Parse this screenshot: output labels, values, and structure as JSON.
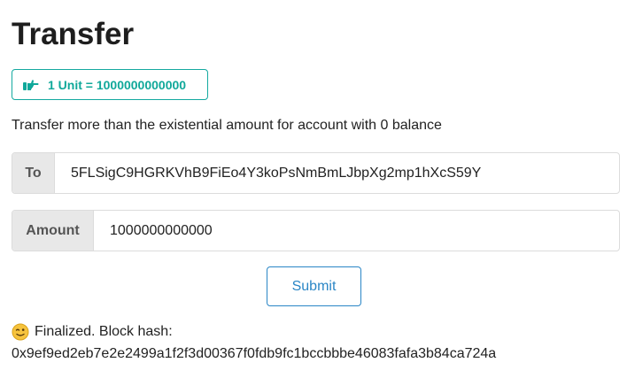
{
  "page": {
    "title": "Transfer"
  },
  "unit_badge": {
    "icon": "hand-pointing-right-icon",
    "text": "1 Unit = 1000000000000",
    "color": "#10a89a"
  },
  "hint": "Transfer more than the existential amount for account with 0 balance",
  "form": {
    "to": {
      "label": "To",
      "value": "5FLSigC9HGRKVhB9FiEo4Y3koPsNmBmLJbpXg2mp1hXcS59Y"
    },
    "amount": {
      "label": "Amount",
      "value": "1000000000000"
    },
    "submit_label": "Submit",
    "submit_color": "#2a86c6"
  },
  "status": {
    "icon": "winking-face-icon",
    "text": "Finalized. Block hash:",
    "hash": "0x9ef9ed2eb7e2e2499a1f2f3d00367f0fdb9fc1bccbbbe46083fafa3b84ca724a"
  }
}
